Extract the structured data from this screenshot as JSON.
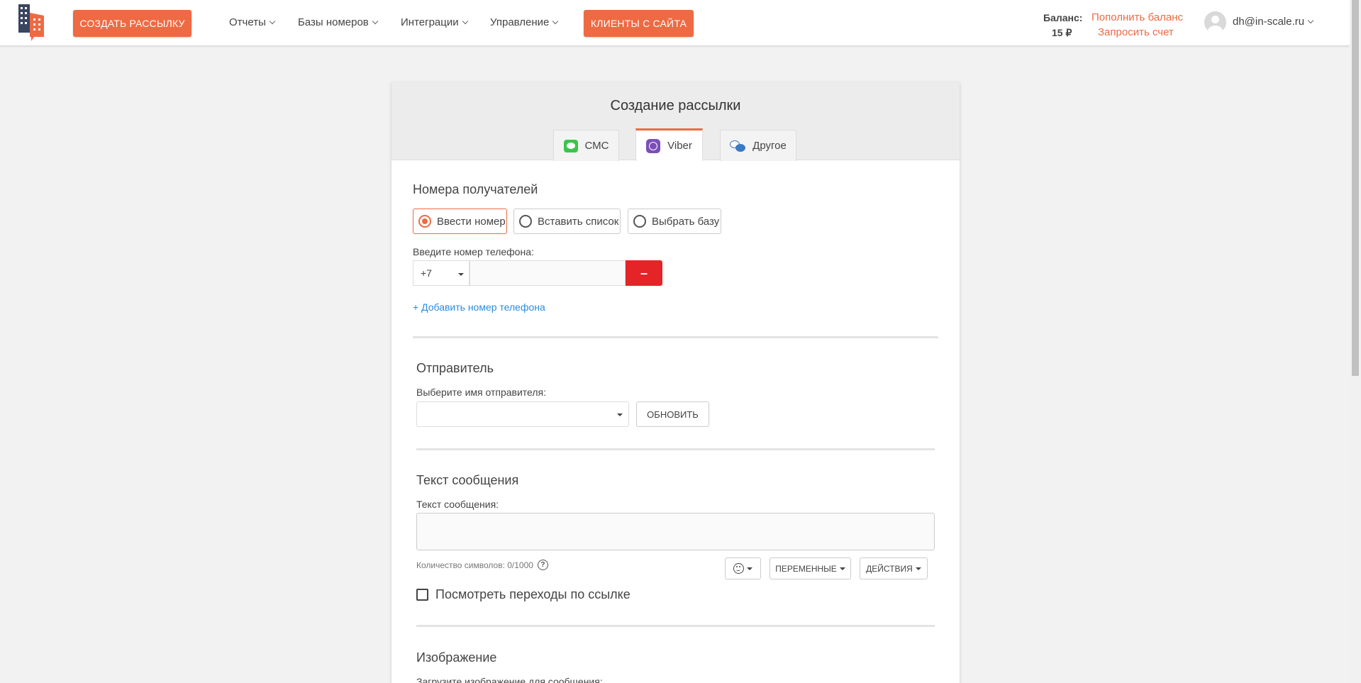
{
  "header": {
    "create_button": "СОЗДАТЬ РАССЫЛКУ",
    "nav": [
      "Отчеты",
      "Базы номеров",
      "Интеграции",
      "Управление"
    ],
    "clients_button": "КЛИЕНТЫ С САЙТА",
    "balance_label": "Баланс:",
    "balance_value": "15 ₽",
    "topup_link": "Пополнить баланс",
    "invoice_link": "Запросить счет",
    "user_email": "dh@in-scale.ru"
  },
  "card": {
    "title": "Создание рассылки",
    "tabs": [
      {
        "label": "СМС",
        "icon": "sms-icon"
      },
      {
        "label": "Viber",
        "icon": "viber-icon",
        "active": true
      },
      {
        "label": "Другое",
        "icon": "chat-icon"
      }
    ]
  },
  "recipients": {
    "title": "Номера получателей",
    "options": [
      "Ввести номер",
      "Вставить список",
      "Выбрать базу"
    ],
    "selected": "Ввести номер",
    "phone_label": "Введите номер телефона:",
    "country_code": "+7",
    "remove_button": "–",
    "add_phone_link": "+ Добавить номер телефона"
  },
  "sender": {
    "title": "Отправитель",
    "select_label": "Выберите имя отправителя:",
    "refresh_button": "ОБНОВИТЬ"
  },
  "message": {
    "title": "Текст сообщения",
    "textarea_label": "Текст сообщения:",
    "char_count": "Количество символов: 0/1000",
    "help_icon_text": "?",
    "variables_button": "ПЕРЕМЕННЫЕ",
    "actions_button": "ДЕЙСТВИЯ",
    "track_links_label": "Посмотреть переходы по ссылке"
  },
  "image": {
    "title": "Изображение",
    "upload_label": "Загрузите изображение для сообщения:"
  },
  "colors": {
    "accent": "#ee6a43",
    "danger": "#e52428",
    "link": "#2b8be0"
  }
}
